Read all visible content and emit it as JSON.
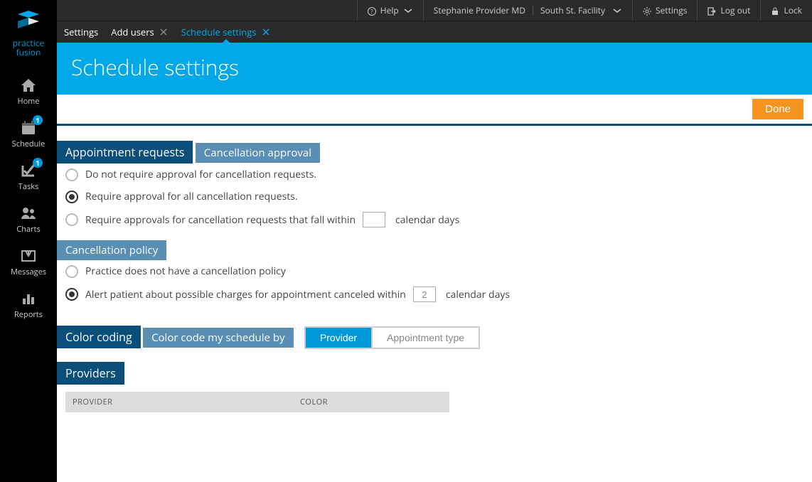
{
  "brand": {
    "line1": "practice",
    "line2": "fusion"
  },
  "sidebar": {
    "items": [
      {
        "label": "Home",
        "icon": "home-icon",
        "badge": null
      },
      {
        "label": "Schedule",
        "icon": "calendar-icon",
        "badge": "1"
      },
      {
        "label": "Tasks",
        "icon": "check-icon",
        "badge": "1"
      },
      {
        "label": "Charts",
        "icon": "people-icon",
        "badge": null
      },
      {
        "label": "Messages",
        "icon": "inbox-icon",
        "badge": null
      },
      {
        "label": "Reports",
        "icon": "barchart-icon",
        "badge": null
      }
    ]
  },
  "topbar": {
    "help": "Help",
    "user": "Stephanie Provider MD",
    "facility": "South St. Facility",
    "settings": "Settings",
    "logout": "Log out",
    "lock": "Lock"
  },
  "tabs": [
    {
      "label": "Settings",
      "closable": false,
      "active": false
    },
    {
      "label": "Add users",
      "closable": true,
      "active": false
    },
    {
      "label": "Schedule settings",
      "closable": true,
      "active": true
    }
  ],
  "page_title": "Schedule settings",
  "actions": {
    "done": "Done"
  },
  "sections": {
    "appointment_requests": {
      "title": "Appointment requests",
      "cancellation_approval": {
        "title": "Cancellation approval",
        "options": [
          "Do not require approval for cancellation requests.",
          "Require approval for all cancellation requests.",
          "Require approvals for cancellation requests that fall within"
        ],
        "suffix": "calendar days",
        "days_value": "",
        "selected": 1
      },
      "cancellation_policy": {
        "title": "Cancellation policy",
        "options": [
          "Practice does not have a cancellation policy",
          "Alert patient about possible charges for appointment canceled within"
        ],
        "suffix": "calendar days",
        "days_value": "2",
        "selected": 1
      }
    },
    "color_coding": {
      "title": "Color coding",
      "subtitle": "Color code my schedule by",
      "toggle": {
        "options": [
          "Provider",
          "Appointment type"
        ],
        "selected": 0
      }
    },
    "providers": {
      "title": "Providers",
      "columns": [
        "PROVIDER",
        "COLOR"
      ]
    }
  }
}
